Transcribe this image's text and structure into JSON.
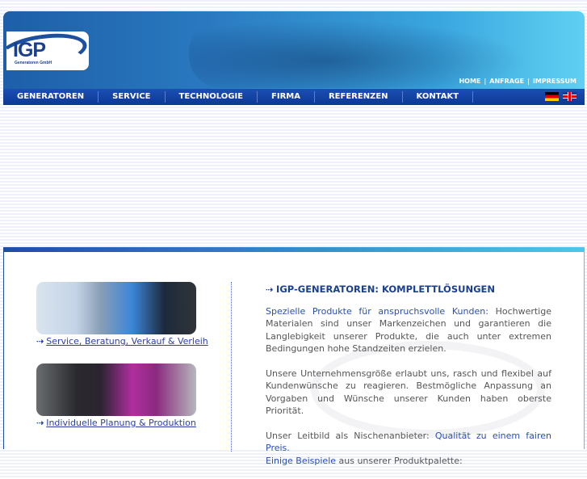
{
  "logo": {
    "name": "IGP",
    "subtitle": "Generatoren GmbH"
  },
  "top_links": [
    "HOME",
    "ANFRAGE",
    "IMPRESSUM"
  ],
  "nav": [
    "GENERATOREN",
    "SERVICE",
    "TECHNOLOGIE",
    "FIRMA",
    "REFERENZEN",
    "KONTAKT"
  ],
  "flags": {
    "de": "Deutsch",
    "en": "English"
  },
  "left": {
    "link1": "Service, Beratung, Verkauf & Verleih",
    "link2": "Individuelle Planung & Produktion"
  },
  "content": {
    "title": "IGP-GENERATOREN: KOMPLETTLÖSUNGEN",
    "p1_hl": "Spezielle Produkte für anspruchsvolle Kunden:",
    "p1": " Hochwertige Materialen sind unser Markenzeichen und garantieren die Langlebigkeit unserer Produkte, die auch unter extremen Bedingungen hohe Standzeiten erzielen.",
    "p2": "Unsere Unternehmensgröße erlaubt uns, rasch und flexibel auf Kundenwünsche zu reagieren. Bestmögliche Anpassung an Vorgaben und Wünsche unserer Kunden haben oberste Priorität.",
    "p3_a": "Unser Leitbild als Nischenanbieter: ",
    "p3_hl": "Qualität zu einem fairen Preis.",
    "p3_hl2": "Einige Beispiele",
    "p3_b": " aus unserer Produktpalette:"
  }
}
